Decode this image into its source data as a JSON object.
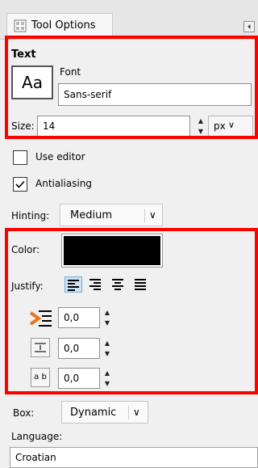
{
  "tab": {
    "label": "Tool Options",
    "icon": "tool-options-icon"
  },
  "text_section": {
    "title": "Text",
    "font_label": "Font",
    "font_preview": "Aa",
    "font_value": "Sans-serif",
    "size_label": "Size:",
    "size_value": "14",
    "unit_value": "px"
  },
  "options": {
    "use_editor_label": "Use editor",
    "use_editor_checked": false,
    "antialiasing_label": "Antialiasing",
    "antialiasing_checked": true,
    "hinting_label": "Hinting:",
    "hinting_value": "Medium"
  },
  "style_section": {
    "color_label": "Color:",
    "color_value": "#000000",
    "justify_label": "Justify:",
    "indent_value": "0,0",
    "line_spacing_value": "0,0",
    "letter_spacing_value": "0,0",
    "letter_spacing_icon_text": "a b"
  },
  "box": {
    "label": "Box:",
    "value": "Dynamic"
  },
  "language": {
    "label": "Language:",
    "value": "Croatian"
  },
  "colors": {
    "highlight": "#ff0000",
    "indent_accent": "#e8731e"
  }
}
